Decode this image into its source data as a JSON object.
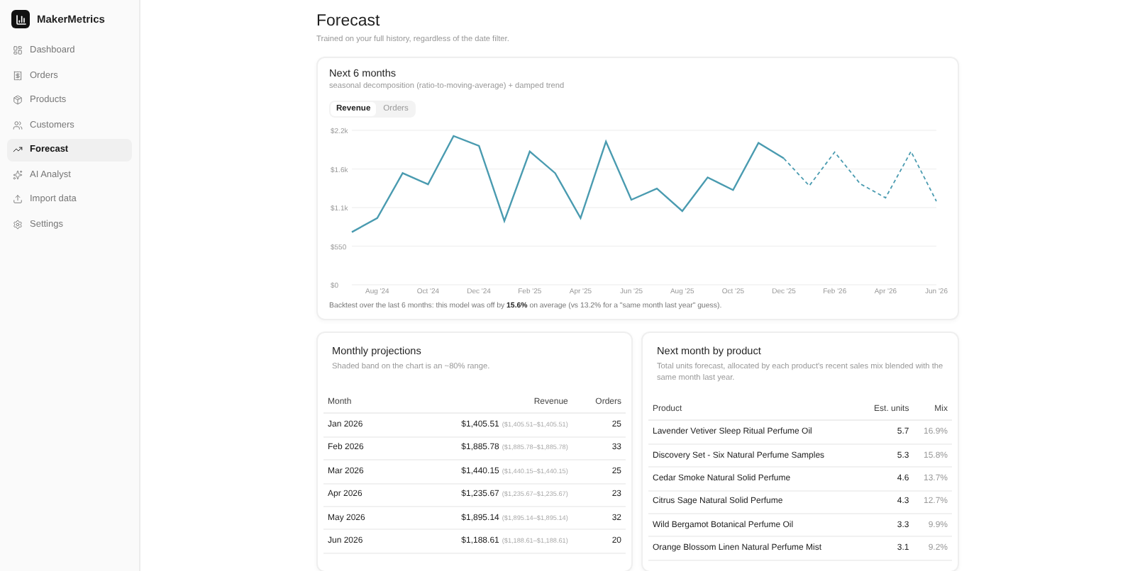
{
  "app": {
    "name": "MakerMetrics"
  },
  "sidebar": {
    "items": [
      {
        "label": "Dashboard",
        "selected": false
      },
      {
        "label": "Orders",
        "selected": false
      },
      {
        "label": "Products",
        "selected": false
      },
      {
        "label": "Customers",
        "selected": false
      },
      {
        "label": "Forecast",
        "selected": true
      },
      {
        "label": "AI Analyst",
        "selected": false
      },
      {
        "label": "Import data",
        "selected": false
      },
      {
        "label": "Settings",
        "selected": false
      }
    ]
  },
  "page": {
    "title": "Forecast",
    "subtitle": "Trained on your full history, regardless of the date filter."
  },
  "forecast_card": {
    "title": "Next 6 months",
    "subtitle": "seasonal decomposition (ratio-to-moving-average) + damped trend",
    "tabs": [
      {
        "label": "Revenue",
        "selected": true
      },
      {
        "label": "Orders",
        "selected": false
      }
    ],
    "chart_data": {
      "type": "line",
      "categories": [
        null,
        "Aug '24",
        null,
        "Oct '24",
        null,
        "Dec '24",
        null,
        "Feb '25",
        null,
        "Apr '25",
        null,
        "Jun '25",
        null,
        "Aug '25",
        null,
        "Oct '25",
        null,
        "Dec '25",
        null,
        "Feb '26",
        null,
        "Apr '26",
        null,
        "Jun '26"
      ],
      "grid": true,
      "ylim": [
        0,
        2200
      ],
      "yticks": [
        {
          "value": 0,
          "label": "$0"
        },
        {
          "value": 550,
          "label": "$550"
        },
        {
          "value": 1100,
          "label": "$1.1k"
        },
        {
          "value": 1650,
          "label": "$1.6k"
        },
        {
          "value": 2200,
          "label": "$2.2k"
        }
      ],
      "series": [
        {
          "color": "#4a9bb0",
          "line_style": "solid",
          "values": [
            750,
            950,
            1590,
            1430,
            2120,
            1980,
            910,
            1900,
            1590,
            950,
            2040,
            1210,
            1370,
            1050,
            1530,
            1350,
            2020,
            1800,
            null,
            null,
            null,
            null,
            null,
            null
          ]
        },
        {
          "color": "#4a9bb0",
          "line_style": "dashed",
          "values": [
            null,
            null,
            null,
            null,
            null,
            null,
            null,
            null,
            null,
            null,
            null,
            null,
            null,
            null,
            null,
            null,
            null,
            1800,
            1410,
            1890,
            1440,
            1240,
            1900,
            1190
          ]
        }
      ]
    },
    "note": "Backtest over the last 6 months: this model was off by **15.6%** on average (vs 13.2% for a \"same month last year\" guess)."
  },
  "projections": {
    "title": "Monthly projections",
    "subtitle": "Shaded band on the chart is an ~80% range.",
    "columns": [
      "Month",
      "Revenue",
      "Orders"
    ],
    "rows": [
      {
        "month": "Jan 2026",
        "revenue": "$1,405.51",
        "range": "($1,405.51–$1,405.51)",
        "orders": "25"
      },
      {
        "month": "Feb 2026",
        "revenue": "$1,885.78",
        "range": "($1,885.78–$1,885.78)",
        "orders": "33"
      },
      {
        "month": "Mar 2026",
        "revenue": "$1,440.15",
        "range": "($1,440.15–$1,440.15)",
        "orders": "25"
      },
      {
        "month": "Apr 2026",
        "revenue": "$1,235.67",
        "range": "($1,235.67–$1,235.67)",
        "orders": "23"
      },
      {
        "month": "May 2026",
        "revenue": "$1,895.14",
        "range": "($1,895.14–$1,895.14)",
        "orders": "32"
      },
      {
        "month": "Jun 2026",
        "revenue": "$1,188.61",
        "range": "($1,188.61–$1,188.61)",
        "orders": "20"
      }
    ]
  },
  "by_product": {
    "title": "Next month by product",
    "subtitle": "Total units forecast, allocated by each product's recent sales mix blended with the same month last year.",
    "columns": [
      "Product",
      "Est. units",
      "Mix"
    ],
    "rows": [
      {
        "product": "Lavender Vetiver Sleep Ritual Perfume Oil",
        "units": "5.7",
        "mix": "16.9%"
      },
      {
        "product": "Discovery Set - Six Natural Perfume Samples",
        "units": "5.3",
        "mix": "15.8%"
      },
      {
        "product": "Cedar Smoke Natural Solid Perfume",
        "units": "4.6",
        "mix": "13.7%"
      },
      {
        "product": "Citrus Sage Natural Solid Perfume",
        "units": "4.3",
        "mix": "12.7%"
      },
      {
        "product": "Wild Bergamot Botanical Perfume Oil",
        "units": "3.3",
        "mix": "9.9%"
      },
      {
        "product": "Orange Blossom Linen Natural Perfume Mist",
        "units": "3.1",
        "mix": "9.2%"
      }
    ]
  }
}
